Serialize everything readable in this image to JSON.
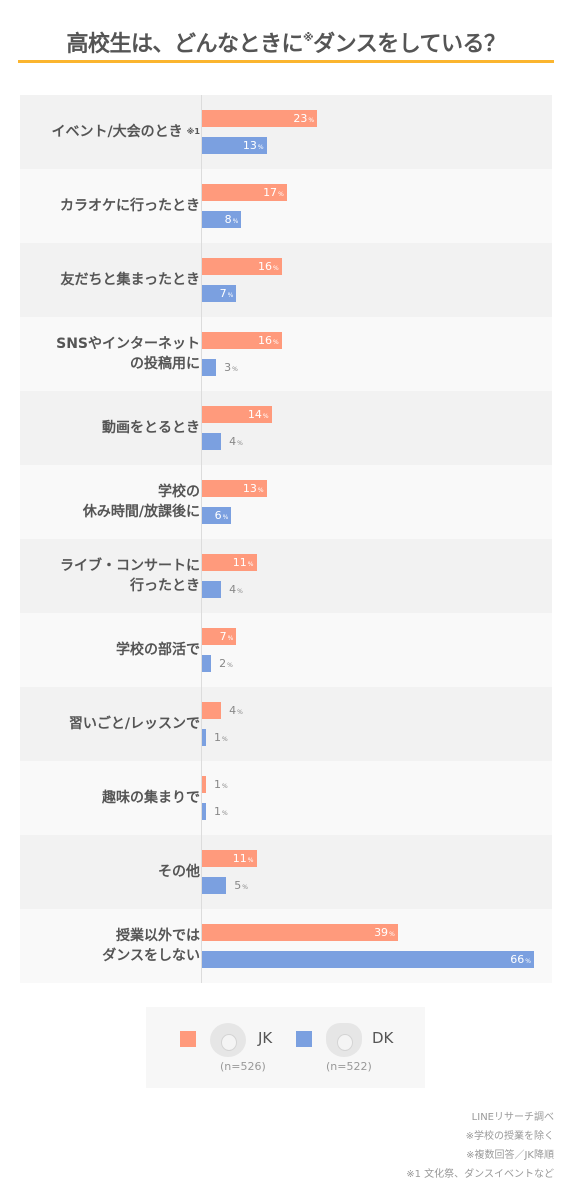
{
  "title": "高校生は、どんなときに",
  "title_mark": "※",
  "title_tail": "ダンスをしている？",
  "colors": {
    "jk": "#ff9a7c",
    "dk": "#7ba0e0",
    "accent": "#fbb52f"
  },
  "chart_data": {
    "type": "bar",
    "orientation": "horizontal",
    "title": "高校生は、どんなときに※ダンスをしている？",
    "unit": "%",
    "xlim": [
      0,
      66
    ],
    "categories": [
      "イベント/大会のとき",
      "カラオケに行ったとき",
      "友だちと集まったとき",
      "SNSやインターネット\nの投稿用に",
      "動画をとるとき",
      "学校の\n休み時間/放課後に",
      "ライブ・コンサートに\n行ったとき",
      "学校の部活で",
      "習いごと/レッスンで",
      "趣味の集まりで",
      "その他",
      "授業以外では\nダンスをしない"
    ],
    "category_notes": [
      "※1",
      "",
      "",
      "",
      "",
      "",
      "",
      "",
      "",
      "",
      "",
      ""
    ],
    "series": [
      {
        "name": "JK",
        "n": "(n=526)",
        "values": [
          23,
          17,
          16,
          16,
          14,
          13,
          11,
          7,
          4,
          1,
          11,
          39
        ]
      },
      {
        "name": "DK",
        "n": "(n=522)",
        "values": [
          13,
          8,
          7,
          3,
          4,
          6,
          4,
          2,
          1,
          1,
          5,
          66
        ]
      }
    ],
    "legend": "bottom-center"
  },
  "legend": {
    "jk_label": "JK",
    "jk_n": "(n=526)",
    "dk_label": "DK",
    "dk_n": "(n=522)"
  },
  "notes": [
    "LINEリサーチ調べ",
    "※学校の授業を除く",
    "※複数回答／JK降順",
    "※1 文化祭、ダンスイベントなど"
  ]
}
